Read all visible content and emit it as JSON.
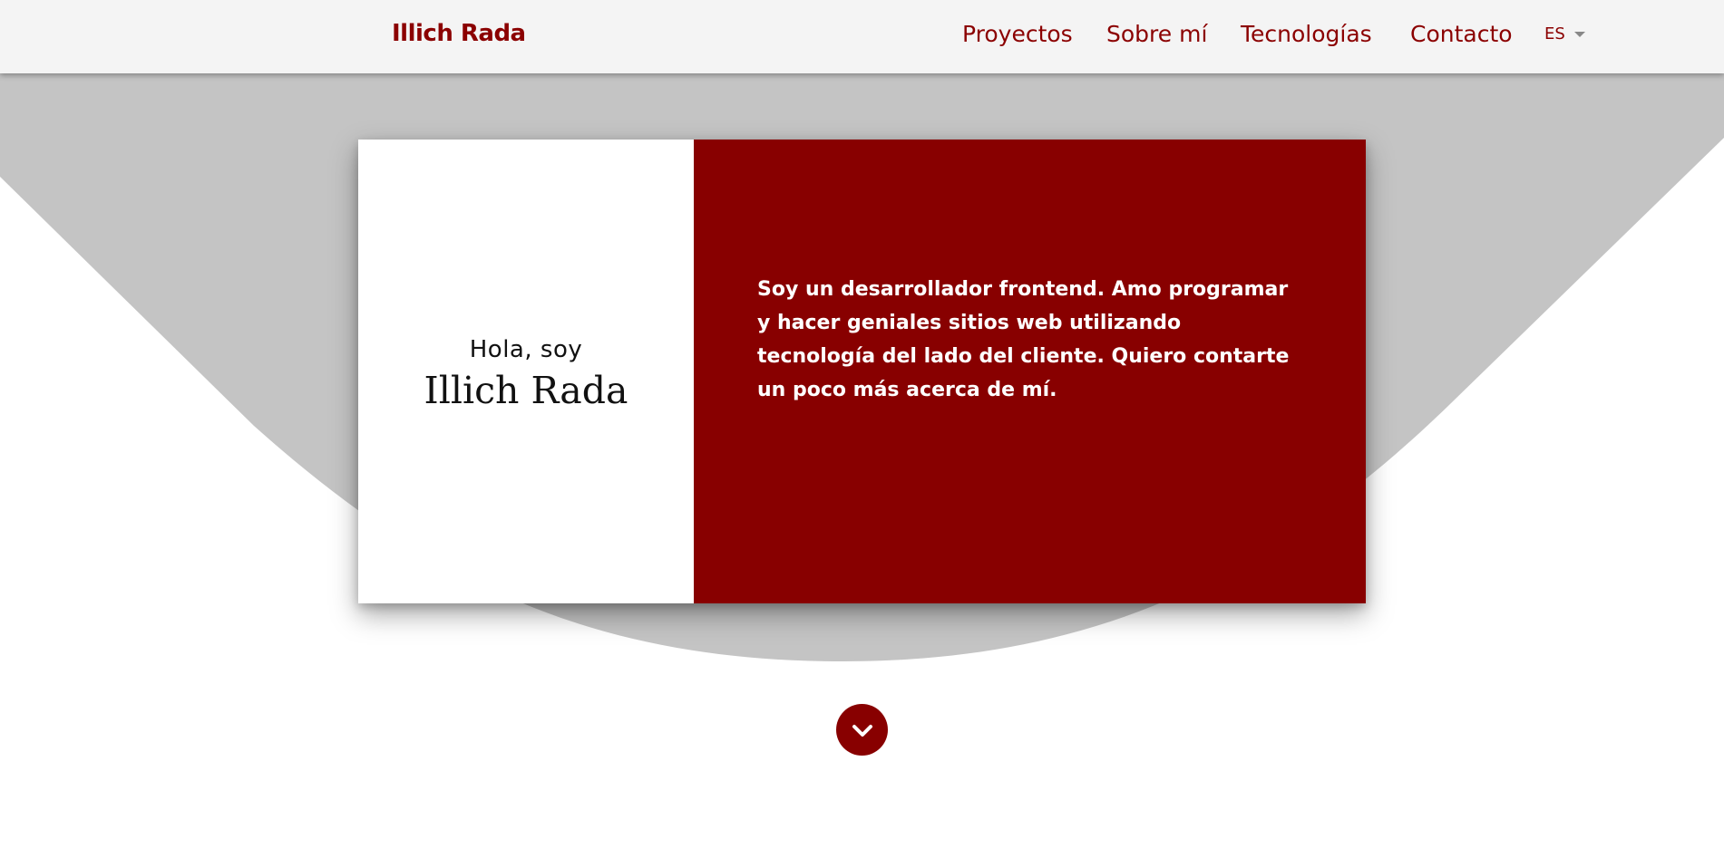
{
  "header": {
    "brand": "Illich Rada",
    "nav": [
      {
        "label": "Proyectos"
      },
      {
        "label": "Sobre mí"
      },
      {
        "label": "Tecnologías"
      },
      {
        "label": "Contacto"
      }
    ],
    "language": {
      "selected": "ES",
      "icon": "caret-down-icon"
    }
  },
  "hero": {
    "greeting": "Hola, soy",
    "name": "Illich Rada",
    "intro": "Soy un desarrollador frontend. Amo programar y hacer geniales sitios web utilizando tecnología del lado del cliente. Quiero contarte un poco más acerca de mí."
  },
  "scroll": {
    "icon": "chevron-down-icon"
  },
  "colors": {
    "accent": "#880000",
    "brand_text": "#8b0000",
    "header_bg": "#f4f4f4",
    "wave_bg": "#c4c4c4",
    "page_bg": "#ffffff"
  }
}
